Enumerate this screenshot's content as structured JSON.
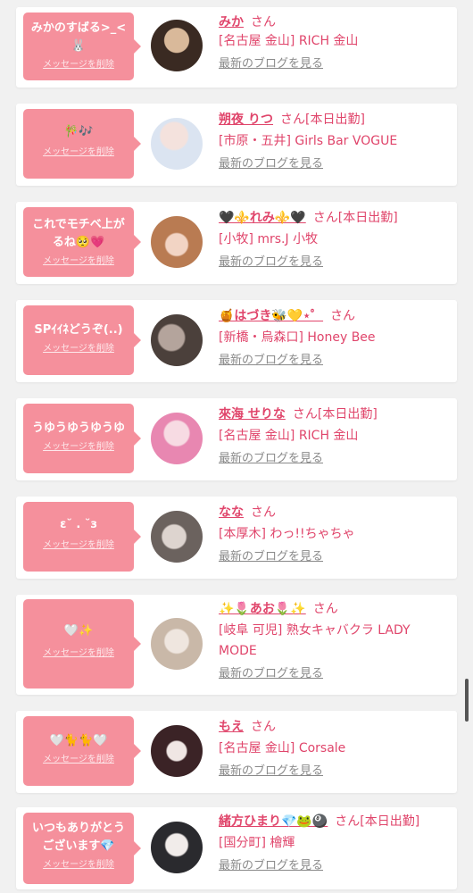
{
  "delete_label": "メッセージを削除",
  "blog_label": "最新のブログを見る",
  "san": "さん",
  "accent_color": "#f5909c",
  "entries": [
    {
      "message": "みかのすばる>_<🐰",
      "name": "みか",
      "status": "",
      "shop": "[名古屋 金山] RICH 金山"
    },
    {
      "message": "🎋🎶",
      "name": "朔夜 りつ",
      "status": "[本日出勤]",
      "shop": "[市原・五井] Girls Bar VOGUE"
    },
    {
      "message": "これでモチベ上がるね🥺💗",
      "name": "🖤⚜️れみ⚜️🖤",
      "status": "[本日出勤]",
      "shop": "[小牧] mrs.J 小牧"
    },
    {
      "message": "SPｲｲﾈどうぞ(..)",
      "name": "🍯はづき🐝💛⋆゜",
      "status": "",
      "shop": "[新橋・烏森口] Honey Bee"
    },
    {
      "message": "うゆうゆうゆうゆ",
      "name": "來海 せりな",
      "status": "[本日出勤]",
      "shop": "[名古屋 金山] RICH 金山"
    },
    {
      "message": "ε˘ . ˘з",
      "name": "なな",
      "status": "",
      "shop": "[本厚木] わっ!!ちゃちゃ"
    },
    {
      "message": "🤍✨",
      "name": "✨🌷あお🌷✨",
      "status": "",
      "shop": "[岐阜 可児] 熟女キャバクラ LADY MODE"
    },
    {
      "message": "🤍🐈🐈🤍",
      "name": "もえ",
      "status": "",
      "shop": "[名古屋 金山] Corsale"
    },
    {
      "message": "いつもありがとうございます💎",
      "name": "緒方ひまり💎🐸🎱",
      "status": "[本日出勤]",
      "shop": "[国分町] 檜輝"
    }
  ]
}
